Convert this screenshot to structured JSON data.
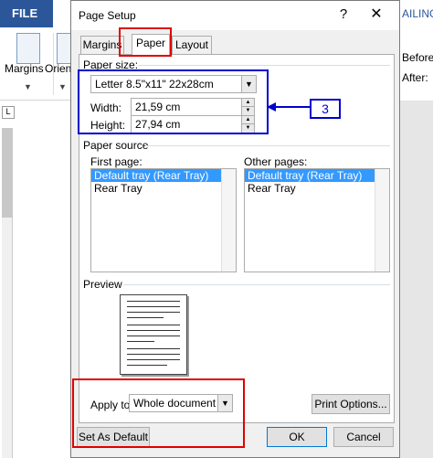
{
  "background": {
    "file_tab": "FILE",
    "ribbon_right_tab": "AILING",
    "ribbon_items": [
      "Margins",
      "Orient"
    ],
    "right_labels": [
      "Before:",
      "After:"
    ],
    "ruler_corner_symbol": "L"
  },
  "dialog": {
    "title": "Page Setup",
    "help_label": "?",
    "close_label": "✕",
    "tabs": [
      {
        "label": "Margins",
        "active": false
      },
      {
        "label": "Paper",
        "active": true
      },
      {
        "label": "Layout",
        "active": false
      }
    ],
    "paper_size": {
      "group_label": "Paper size:",
      "selected": "Letter 8.5\"x11\" 22x28cm",
      "width_label": "Width:",
      "width_value": "21,59 cm",
      "height_label": "Height:",
      "height_value": "27,94 cm"
    },
    "paper_source": {
      "group_label": "Paper source",
      "first_page_label": "First page:",
      "first_page_items": [
        "Default tray (Rear Tray)",
        "Rear Tray"
      ],
      "first_page_selected": 0,
      "other_pages_label": "Other pages:",
      "other_pages_items": [
        "Default tray (Rear Tray)",
        "Rear Tray"
      ],
      "other_pages_selected": 0
    },
    "preview": {
      "group_label": "Preview",
      "apply_to_label": "Apply to:",
      "apply_to_value": "Whole document",
      "print_options_label": "Print Options..."
    },
    "buttons": {
      "set_default": "Set As Default",
      "ok": "OK",
      "cancel": "Cancel"
    }
  },
  "annotations": {
    "callout_text": "3",
    "red_color": "#e00000",
    "blue_color": "#0000cc"
  }
}
